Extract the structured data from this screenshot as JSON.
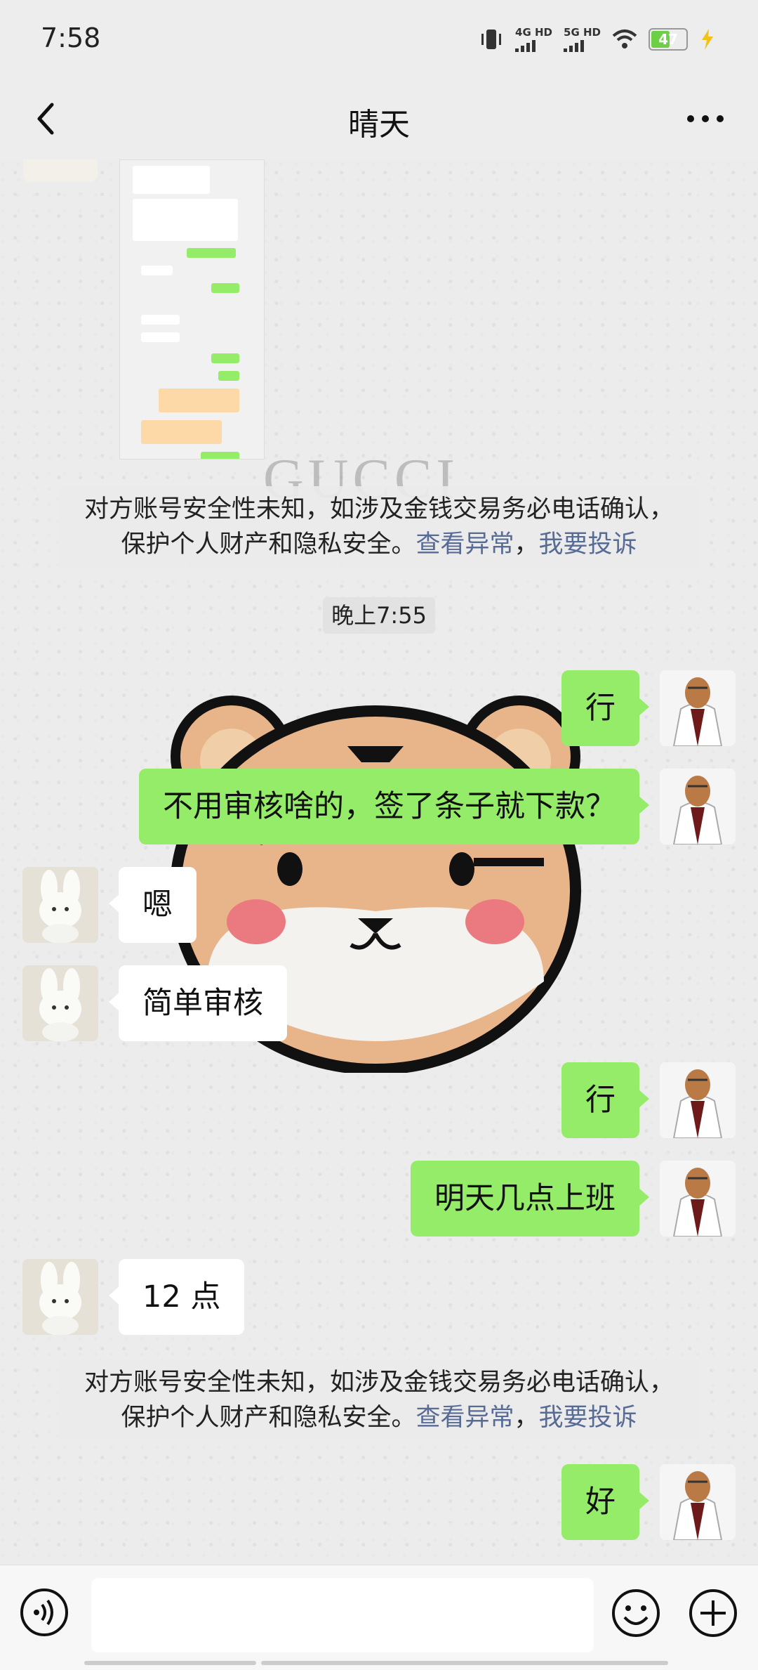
{
  "status_bar": {
    "time": "7:58",
    "sim1": "4G HD",
    "sim2": "5G HD",
    "battery": "47"
  },
  "header": {
    "title": "晴天"
  },
  "chat": {
    "watermark": "GUCCI",
    "security_notice": {
      "text": "对方账号安全性未知，如涉及金钱交易务必电话确认，",
      "text2": "保护个人财产和隐私安全。",
      "link1": "查看异常",
      "sep": "，",
      "link2": "我要投诉"
    },
    "timestamp": "晚上7:55",
    "messages": [
      {
        "from": "me",
        "text": "行"
      },
      {
        "from": "me",
        "text": "不用审核啥的，签了条子就下款？"
      },
      {
        "from": "them",
        "text": "嗯"
      },
      {
        "from": "them",
        "text": "简单审核"
      },
      {
        "from": "me",
        "text": "行"
      },
      {
        "from": "me",
        "text": "明天几点上班"
      },
      {
        "from": "them",
        "text": "12 点"
      },
      {
        "from": "me",
        "text": "好"
      }
    ]
  },
  "colors": {
    "my_bubble": "#95ec69",
    "their_bubble": "#ffffff",
    "link": "#576b95"
  }
}
